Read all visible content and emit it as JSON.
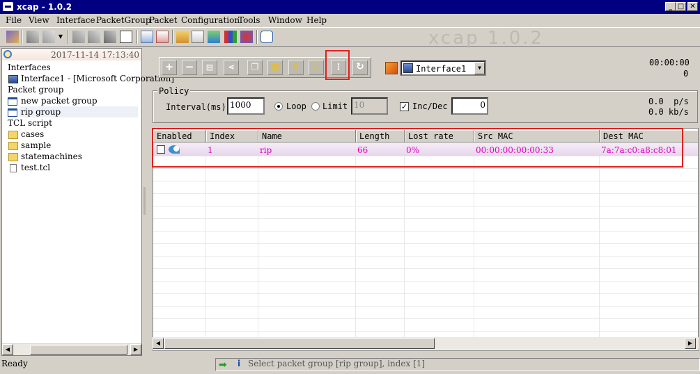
{
  "window": {
    "title": "xcap - 1.0.2",
    "watermark": "xcap 1.0.2"
  },
  "menu": [
    "File",
    "View",
    "Interface",
    "PacketGroup",
    "Packet",
    "Configuration",
    "Tools",
    "Window",
    "Help"
  ],
  "left_panel": {
    "datetime": "2017-11-14 17:13:40",
    "tree": [
      {
        "label": "Interfaces",
        "level": 0,
        "icon": "interfaces-icon"
      },
      {
        "label": "Interface1 - [Microsoft Corporation]",
        "level": 1,
        "icon": "network-card-icon"
      },
      {
        "label": "Packet group",
        "level": 0,
        "icon": "none"
      },
      {
        "label": "new packet group",
        "level": 1,
        "icon": "packet-group-icon"
      },
      {
        "label": "rip group",
        "level": 1,
        "icon": "packet-group-icon",
        "selected": true
      },
      {
        "label": "TCL script",
        "level": 0,
        "icon": "none"
      },
      {
        "label": "cases",
        "level": 1,
        "icon": "folder-icon"
      },
      {
        "label": "sample",
        "level": 1,
        "icon": "folder-icon"
      },
      {
        "label": "statemachines",
        "level": 1,
        "icon": "folder-icon"
      },
      {
        "label": "test.tcl",
        "level": 1,
        "icon": "file-icon"
      }
    ]
  },
  "control": {
    "interface_select": "Interface1",
    "counter_time": "00:00:00",
    "counter_value": "0"
  },
  "policy": {
    "legend": "Policy",
    "interval_label": "Interval(ms)",
    "interval_value": "1000",
    "loop_label": "Loop",
    "limit_label": "Limit",
    "limit_value": "10",
    "incdec_label": "Inc/Dec",
    "incdec_value": "0",
    "rate_pps": "0.0  p/s",
    "rate_kbps": "0.0 kb/s"
  },
  "table": {
    "columns": [
      "Enabled",
      "Index",
      "Name",
      "Length",
      "Lost rate",
      "Src MAC",
      "Dest MAC"
    ],
    "rows": [
      {
        "enabled": false,
        "index": "1",
        "name": "rip",
        "length": "66",
        "lost_rate": "0%",
        "src_mac": "00:00:00:00:00:33",
        "dest_mac": "7a:7a:c0:a8:c8:01"
      }
    ]
  },
  "status": {
    "ready": "Ready",
    "message": "Select packet group [rip group], index [1]"
  },
  "colors": {
    "title_bar": "#000080",
    "row_text": "#e000c0",
    "highlight_box": "#e02020"
  }
}
